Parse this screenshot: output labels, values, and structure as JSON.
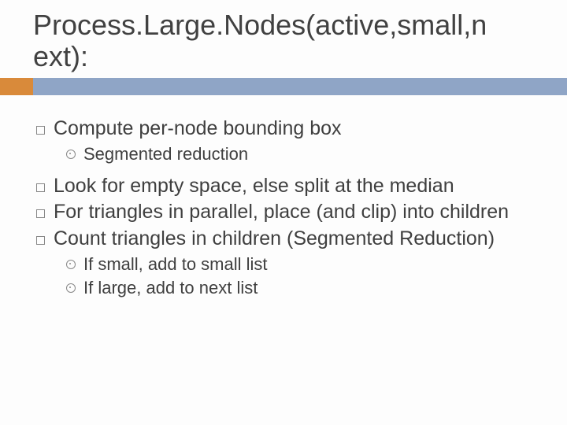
{
  "title": "Process.Large.Nodes(active,small,n ext):",
  "items": [
    {
      "text": "Compute per-node bounding box",
      "sub": [
        "Segmented reduction"
      ]
    },
    {
      "text": "Look for empty space, else split at the median"
    },
    {
      "text": "For triangles in parallel, place (and clip) into children"
    },
    {
      "text": "Count triangles in children (Segmented Reduction)",
      "sub": [
        "If small, add to small list",
        "If large, add to next list"
      ]
    }
  ]
}
